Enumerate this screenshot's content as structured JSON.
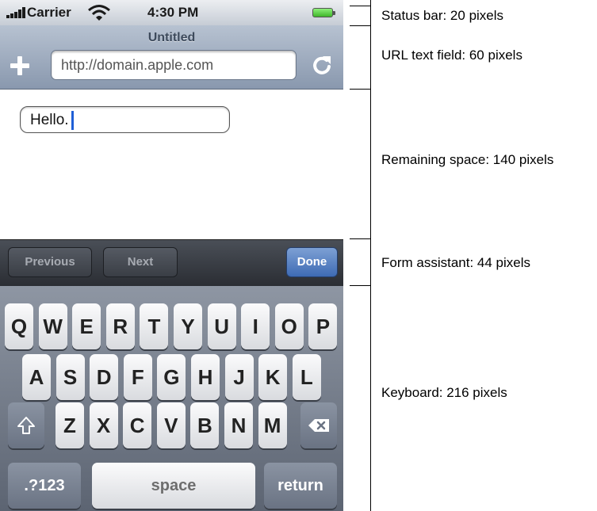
{
  "status_bar": {
    "carrier": "Carrier",
    "time": "4:30 PM"
  },
  "nav_bar": {
    "title": "Untitled",
    "url": "http://domain.apple.com"
  },
  "content": {
    "input_value": "Hello."
  },
  "form_assistant": {
    "previous": "Previous",
    "next": "Next",
    "done": "Done"
  },
  "keyboard": {
    "row1": [
      "Q",
      "W",
      "E",
      "R",
      "T",
      "Y",
      "U",
      "I",
      "O",
      "P"
    ],
    "row2": [
      "A",
      "S",
      "D",
      "F",
      "G",
      "H",
      "J",
      "K",
      "L"
    ],
    "row3": [
      "Z",
      "X",
      "C",
      "V",
      "B",
      "N",
      "M"
    ],
    "numbers": ".?123",
    "space": "space",
    "return": "return"
  },
  "annotations": {
    "status_bar": "Status bar: 20 pixels",
    "url_field": "URL text field: 60 pixels",
    "remaining": "Remaining space: 140 pixels",
    "form_assistant": "Form assistant: 44 pixels",
    "keyboard": "Keyboard: 216 pixels"
  },
  "icons": [
    "signal-bars-icon",
    "wifi-icon",
    "battery-icon",
    "plus-icon",
    "reload-icon",
    "caret-icon",
    "shift-icon",
    "backspace-icon"
  ],
  "colors": {
    "done_button": "#4a77be",
    "caret": "#1f5fd6",
    "nav_bar": "#9eabbd"
  }
}
